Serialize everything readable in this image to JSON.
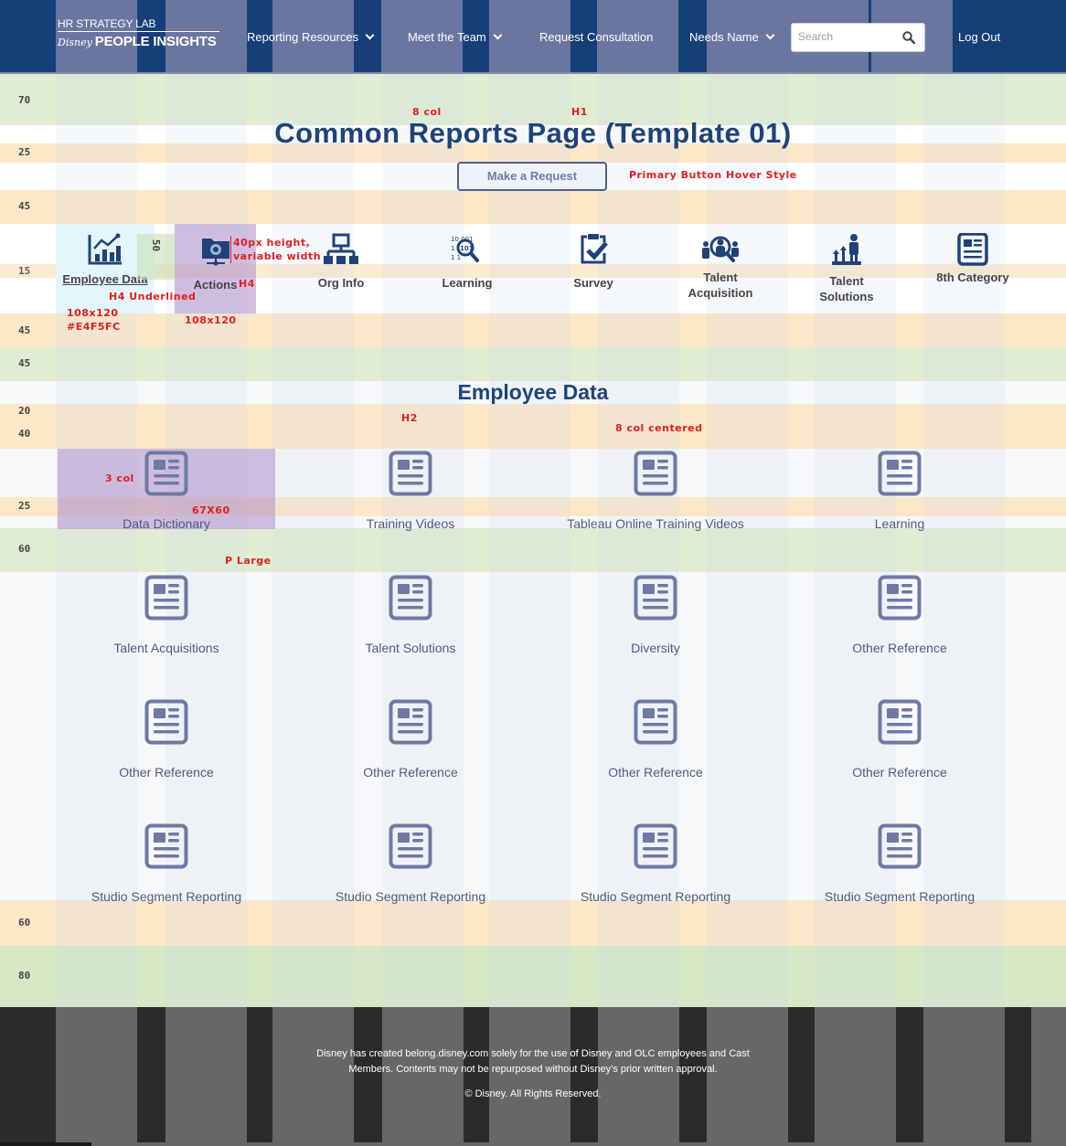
{
  "header": {
    "logo_top": "HR STRATEGY LAB",
    "logo_script": "Disney",
    "logo_brand": "PEOPLE INSIGHTS",
    "nav": [
      {
        "label": "Reporting Resources",
        "has_dropdown": true
      },
      {
        "label": "Meet the Team",
        "has_dropdown": true
      },
      {
        "label": "Request Consultation",
        "has_dropdown": false
      },
      {
        "label": "Needs Name",
        "has_dropdown": true
      }
    ],
    "search": {
      "placeholder": "Search",
      "value": "",
      "icon": "search-icon"
    },
    "logout_label": "Log Out"
  },
  "spacing_labels": [
    "70",
    "25",
    "45",
    "15",
    "45",
    "45",
    "20",
    "40",
    "25",
    "60",
    "60",
    "80"
  ],
  "annotations": {
    "col8": "8 col",
    "h1": "H1",
    "button_style": "Primary Button Hover Style",
    "cat_rotated": "50",
    "icon_size": "40px height,",
    "icon_size_2": "variable width",
    "h4": "H4",
    "h4_underlined": "H4 Underlined",
    "box_size": "108x120",
    "box_color": "#E4F5FC",
    "box_size_2": "108x120",
    "h2": "H2",
    "col8_centered": "8 col centered",
    "col3": "3 col",
    "report_icon_size": "67X60",
    "p_large": "P Large"
  },
  "page": {
    "title": "Common Reports Page (Template 01)",
    "request_button": "Make a Request"
  },
  "categories": [
    {
      "label": "Employee Data",
      "icon": "chart-growth-icon",
      "state": "active"
    },
    {
      "label": "Actions",
      "icon": "network-folder-icon",
      "state": "hover"
    },
    {
      "label": "Org Info",
      "icon": "org-chart-icon",
      "state": "default"
    },
    {
      "label": "Learning",
      "icon": "binary-search-icon",
      "state": "default"
    },
    {
      "label": "Survey",
      "icon": "clipboard-check-icon",
      "state": "default"
    },
    {
      "label": "Talent Acquisition",
      "icon": "people-search-icon",
      "state": "default"
    },
    {
      "label": "Talent Solutions",
      "icon": "career-growth-icon",
      "state": "default"
    },
    {
      "label": "8th Category",
      "icon": "document-icon",
      "state": "default"
    }
  ],
  "section": {
    "title": "Employee Data"
  },
  "reports": [
    {
      "label": "Data Dictionary"
    },
    {
      "label": "Training Videos"
    },
    {
      "label": "Tableau Online Training Videos"
    },
    {
      "label": "Learning"
    },
    {
      "label": "Talent Acquisitions"
    },
    {
      "label": "Talent Solutions"
    },
    {
      "label": "Diversity"
    },
    {
      "label": "Other Reference"
    },
    {
      "label": "Other Reference"
    },
    {
      "label": "Other Reference"
    },
    {
      "label": "Other Reference"
    },
    {
      "label": "Other Reference"
    },
    {
      "label": "Studio Segment Reporting"
    },
    {
      "label": "Studio Segment Reporting"
    },
    {
      "label": "Studio Segment Reporting"
    },
    {
      "label": "Studio Segment Reporting"
    }
  ],
  "footer": {
    "disclaimer_line1": "Disney has created belong.disney.com solely for the use of Disney and OLC employees and Cast",
    "disclaimer_line2": "Members. Contents may not be repurposed without Disney’s prior written approval.",
    "copyright": "© Disney. All Rights Reserved."
  },
  "colors": {
    "brand_navy": "#163F78",
    "grid_column": "#6B76A0",
    "active_category_bg": "#E4F5FC",
    "annotation_red": "#E02020",
    "footer_bg": "#2B2B2B"
  }
}
